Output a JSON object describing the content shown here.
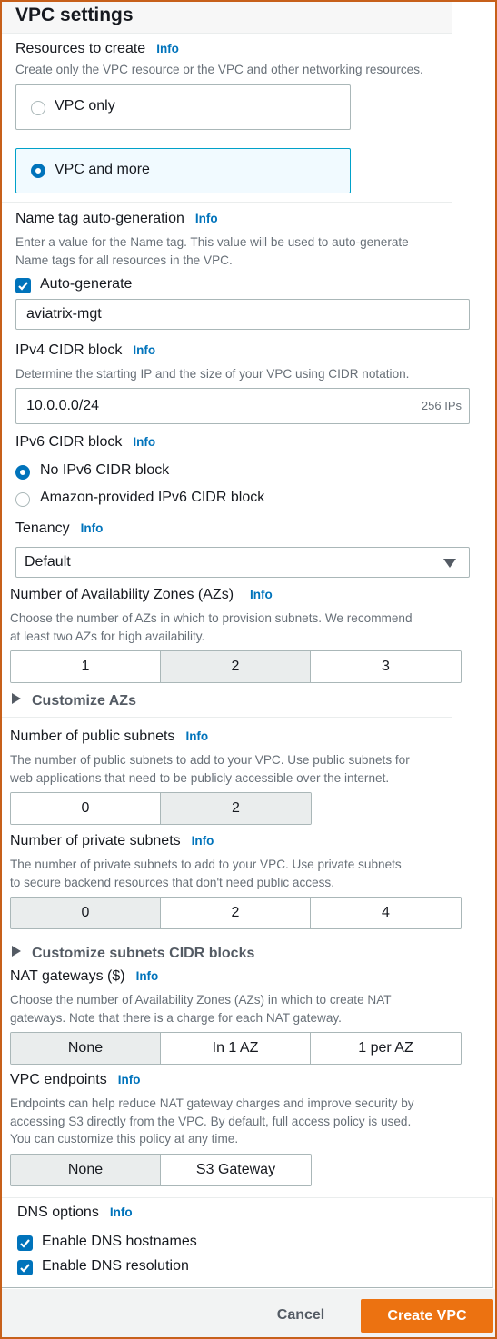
{
  "page": {
    "title": "VPC settings"
  },
  "info_label": "Info",
  "resources": {
    "label": "Resources to create",
    "description": "Create only the VPC resource or the VPC and other networking resources.",
    "options": [
      {
        "label": "VPC only",
        "selected": false
      },
      {
        "label": "VPC and more",
        "selected": true
      }
    ]
  },
  "name_tag": {
    "label": "Name tag auto-generation",
    "description_line1": "Enter a value for the Name tag. This value will be used to auto-generate",
    "description_line2": "Name tags for all resources in the VPC.",
    "auto_generate_label": "Auto-generate",
    "auto_generate_checked": true,
    "value": "aviatrix-mgt"
  },
  "ipv4": {
    "label": "IPv4 CIDR block",
    "description": "Determine the starting IP and the size of your VPC using CIDR notation.",
    "value": "10.0.0.0/24",
    "suffix": "256 IPs"
  },
  "ipv6": {
    "label": "IPv6 CIDR block",
    "options": [
      {
        "label": "No IPv6 CIDR block",
        "selected": true
      },
      {
        "label": "Amazon-provided IPv6 CIDR block",
        "selected": false
      }
    ]
  },
  "tenancy": {
    "label": "Tenancy",
    "selected": "Default"
  },
  "azs": {
    "label": "Number of Availability Zones (AZs)",
    "description_line1": "Choose the number of AZs in which to provision subnets. We recommend",
    "description_line2": "at least two AZs for high availability.",
    "options": [
      "1",
      "2",
      "3"
    ],
    "selected": "2",
    "customize_label": "Customize AZs"
  },
  "public_subnets": {
    "label": "Number of public subnets",
    "description_line1": "The number of public subnets to add to your VPC. Use public subnets for",
    "description_line2": "web applications that need to be publicly accessible over the internet.",
    "options": [
      "0",
      "2"
    ],
    "selected": "2"
  },
  "private_subnets": {
    "label": "Number of private subnets",
    "description_line1": "The number of private subnets to add to your VPC. Use private subnets",
    "description_line2": "to secure backend resources that don't need public access.",
    "options": [
      "0",
      "2",
      "4"
    ],
    "selected": "0",
    "customize_label": "Customize subnets CIDR blocks"
  },
  "nat": {
    "label": "NAT gateways ($)",
    "description_line1": "Choose the number of Availability Zones (AZs) in which to create NAT",
    "description_line2": "gateways. Note that there is a charge for each NAT gateway.",
    "options": [
      "None",
      "In 1 AZ",
      "1 per AZ"
    ],
    "selected": "None"
  },
  "endpoints": {
    "label": "VPC endpoints",
    "description_line1": "Endpoints can help reduce NAT gateway charges and improve security by",
    "description_line2": "accessing S3 directly from the VPC. By default, full access policy is used.",
    "description_line3": "You can customize this policy at any time.",
    "options": [
      "None",
      "S3 Gateway"
    ],
    "selected": "None"
  },
  "dns": {
    "label": "DNS options",
    "options": [
      {
        "label": "Enable DNS hostnames",
        "checked": true
      },
      {
        "label": "Enable DNS resolution",
        "checked": true
      }
    ]
  },
  "footer": {
    "cancel_label": "Cancel",
    "create_label": "Create VPC"
  },
  "colors": {
    "accent": "#0073bb",
    "primary_button": "#ec7211",
    "frame": "#c7601a",
    "selected_segment": "#eaeded"
  }
}
